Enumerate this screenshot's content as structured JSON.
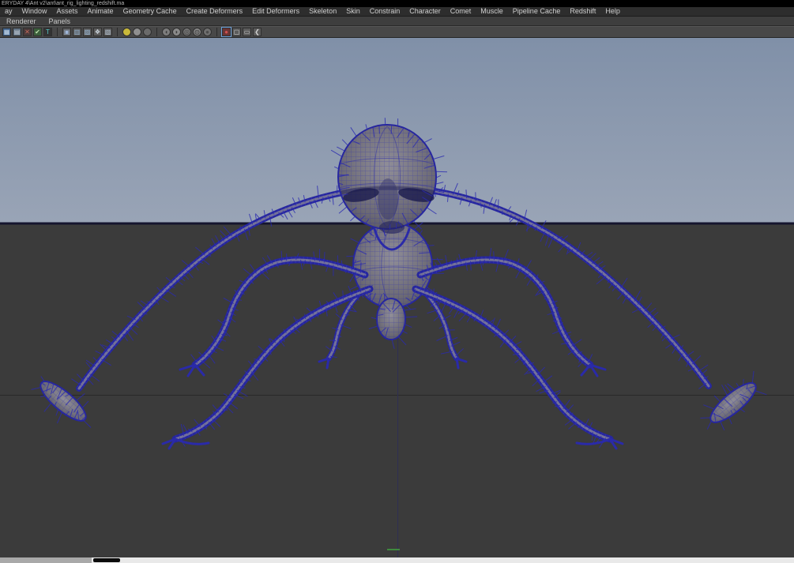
{
  "title_bar": {
    "title": "ERYDAY 4\\Ant v2\\ant\\ant_rig_lighting_redshift.ma"
  },
  "menu_bar": {
    "items": [
      "ay",
      "Window",
      "Assets",
      "Animate",
      "Geometry Cache",
      "Create Deformers",
      "Edit Deformers",
      "Skeleton",
      "Skin",
      "Constrain",
      "Character",
      "Comet",
      "Muscle",
      "Pipeline Cache",
      "Redshift",
      "Help"
    ]
  },
  "panel_menu": {
    "items": [
      "Renderer",
      "Panels"
    ]
  },
  "toolbar": {
    "groups": [
      {
        "name": "display-toggle-group",
        "icons": [
          {
            "name": "grid-display-icon",
            "shape": "square",
            "bg": "#3d5e86",
            "glyph": "▦",
            "fg": "#cfe0f0"
          },
          {
            "name": "panel-layout-icon",
            "shape": "square",
            "bg": "#5a6b7c",
            "glyph": "▤",
            "fg": "#d0d8e0"
          },
          {
            "name": "close-panel-icon",
            "shape": "square",
            "bg": "#4a3b3b",
            "glyph": "✕",
            "fg": "#c96a5a"
          },
          {
            "name": "enable-check-icon",
            "shape": "square",
            "bg": "#3b5e3b",
            "glyph": "✔",
            "fg": "#bfe0b0"
          },
          {
            "name": "type-tool-icon",
            "shape": "square",
            "bg": "#333333",
            "glyph": "T",
            "fg": "#52c8c8"
          }
        ]
      },
      {
        "name": "camera-tool-group",
        "icons": [
          {
            "name": "select-camera-icon",
            "shape": "square",
            "bg": "#5c5c5c",
            "glyph": "▣",
            "fg": "#9fb6d8"
          },
          {
            "name": "lock-camera-icon",
            "shape": "square",
            "bg": "#5c5c5c",
            "glyph": "▥",
            "fg": "#8fb0d0"
          },
          {
            "name": "camera-attributes-icon",
            "shape": "square",
            "bg": "#5c5c5c",
            "glyph": "▨",
            "fg": "#9fc0e0"
          },
          {
            "name": "bookmark-icon",
            "shape": "square",
            "bg": "#5c5c5c",
            "glyph": "❖",
            "fg": "#cfd8e0"
          },
          {
            "name": "image-plane-icon",
            "shape": "square",
            "bg": "#5c5c5c",
            "glyph": "▧",
            "fg": "#b8c8d8"
          }
        ]
      },
      {
        "name": "lighting-group",
        "icons": [
          {
            "name": "default-lighting-icon",
            "shape": "circle",
            "bg": "#c9b93a",
            "glyph": "",
            "fg": "#000000"
          },
          {
            "name": "all-lights-icon",
            "shape": "circle",
            "bg": "#8f8f8f",
            "glyph": "",
            "fg": "#000000"
          },
          {
            "name": "shadows-icon",
            "shape": "circle",
            "bg": "#6a6a6a",
            "glyph": "",
            "fg": "#000000"
          }
        ]
      },
      {
        "name": "shading-group",
        "icons": [
          {
            "name": "isolate-select-icon",
            "shape": "circle",
            "bg": "#7d7d7d",
            "glyph": "◖",
            "fg": "#3c3c3c"
          },
          {
            "name": "xray-icon",
            "shape": "circle",
            "bg": "#8a8a8a",
            "glyph": "◗",
            "fg": "#3c3c3c"
          },
          {
            "name": "wireframe-on-shaded-icon",
            "shape": "circle",
            "bg": "#757575",
            "glyph": "◎",
            "fg": "#3c3c3c"
          },
          {
            "name": "textured-display-icon",
            "shape": "circle",
            "bg": "#888888",
            "glyph": "◍",
            "fg": "#3c3c3c"
          },
          {
            "name": "use-default-material-icon",
            "shape": "circle",
            "bg": "#6f6f6f",
            "glyph": "●",
            "fg": "#4a4a4a"
          }
        ]
      },
      {
        "name": "gate-group",
        "icons": [
          {
            "name": "grease-pencil-icon",
            "shape": "square",
            "bg": "#6a3535",
            "glyph": "●",
            "fg": "#d05050",
            "selected": true
          },
          {
            "name": "resolution-gate-icon",
            "shape": "square",
            "bg": "#5c5c5c",
            "glyph": "▢",
            "fg": "#cfcfcf"
          },
          {
            "name": "film-gate-icon",
            "shape": "square",
            "bg": "#5c5c5c",
            "glyph": "▭",
            "fg": "#cfcfcf"
          },
          {
            "name": "share-view-icon",
            "shape": "square",
            "bg": "#5c5c5c",
            "glyph": "❮",
            "fg": "#cfcfcf"
          }
        ]
      }
    ]
  },
  "viewport": {
    "subject": "ant-wireframe-model",
    "wireframe_color": "#2a2aae",
    "sky_top": "#8090a8",
    "sky_bottom": "#99a4b6",
    "ground_color": "#3b3b3b"
  }
}
